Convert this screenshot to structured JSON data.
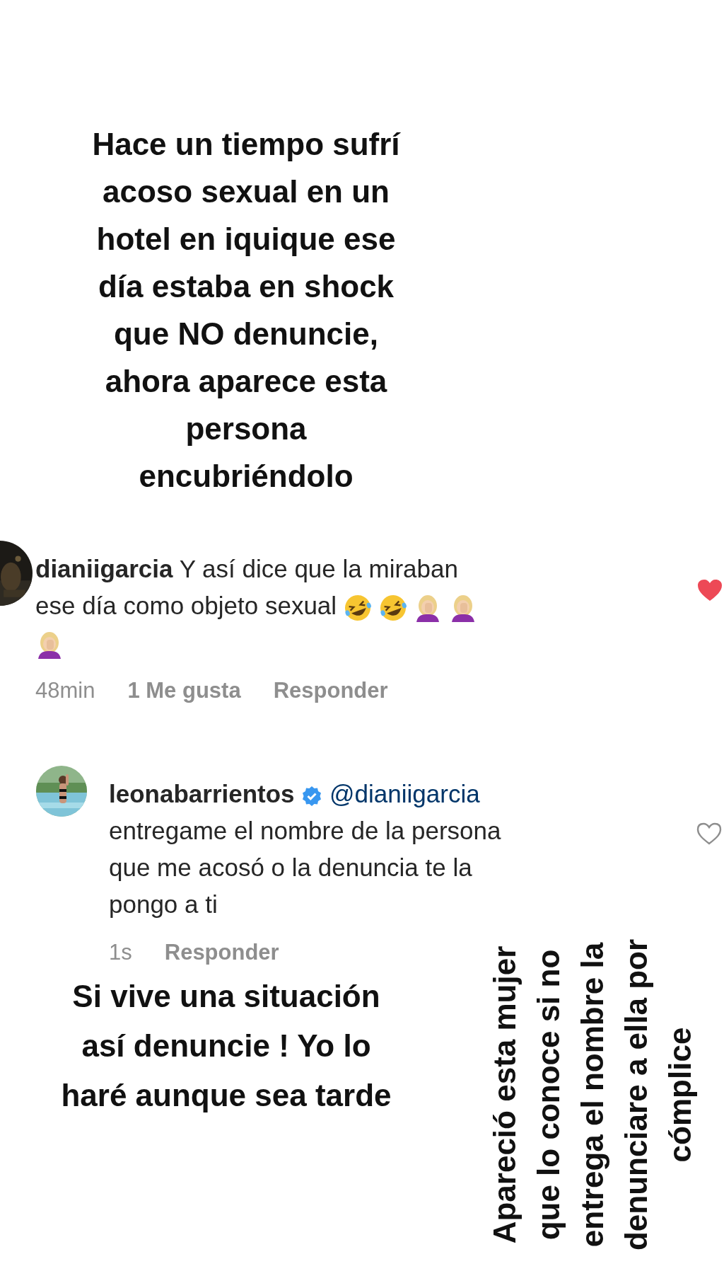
{
  "caption": {
    "text": "Hace un tiempo sufrí\nacoso sexual en un\nhotel en iquique ese\ndía estaba en shock\nque NO denuncie,\nahora aparece esta\npersona\nencubriéndolo"
  },
  "comments": [
    {
      "username": "dianiigarcia",
      "text": "Y así dice que la miraban ese día como objeto sexual",
      "emojis": [
        {
          "kind": "laugh"
        },
        {
          "kind": "laugh"
        },
        {
          "kind": "facepalm"
        },
        {
          "kind": "facepalm"
        },
        {
          "kind": "facepalm"
        }
      ],
      "liked": true,
      "time": "48min",
      "likes": "1 Me gusta",
      "reply": "Responder"
    },
    {
      "username": "leonabarrientos",
      "verified": true,
      "mention": "@dianiigarcia",
      "text": "entregame el nombre de la persona que me acosó o la denuncia te la pongo a ti",
      "liked": false,
      "time": "1s",
      "reply": "Responder"
    }
  ],
  "footer_caption": {
    "text": "Si vive una situación\nasí denuncie ! Yo lo\nharé aunque sea tarde"
  },
  "side_caption": {
    "text": "Apareció esta mujer\nque lo conoce si no\nentrega el nombre la\ndenunciare a ella por\ncómplice"
  }
}
